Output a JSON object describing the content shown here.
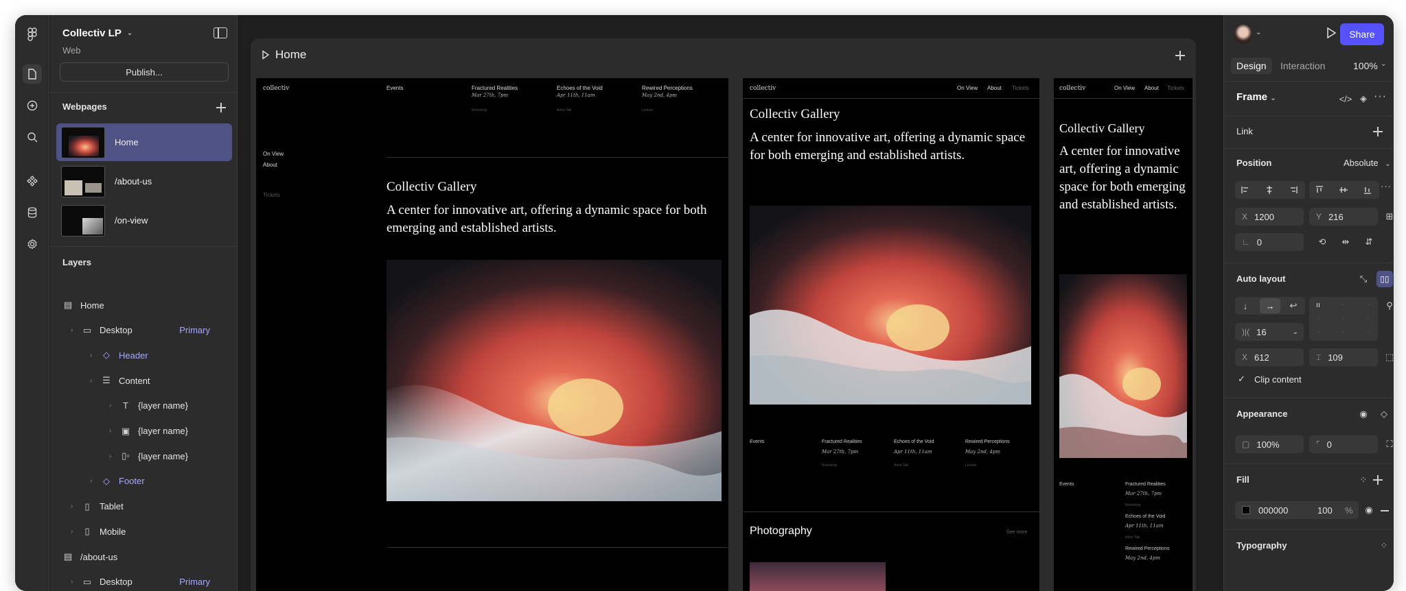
{
  "project": {
    "name": "Collectiv LP",
    "type": "Web",
    "publish_label": "Publish..."
  },
  "webpages": {
    "title": "Webpages",
    "items": [
      {
        "label": "Home",
        "active": true
      },
      {
        "label": "/about-us",
        "active": false
      },
      {
        "label": "/on-view",
        "active": false
      }
    ]
  },
  "layers": {
    "title": "Layers",
    "items": [
      {
        "label": "Home",
        "icon": "page-icon",
        "depth": 0,
        "chevron": false,
        "component": false,
        "tag": ""
      },
      {
        "label": "Desktop",
        "icon": "desktop-icon",
        "depth": 1,
        "chevron": true,
        "component": false,
        "tag": "Primary"
      },
      {
        "label": "Header",
        "icon": "component-icon",
        "depth": 2,
        "chevron": true,
        "component": true,
        "tag": ""
      },
      {
        "label": "Content",
        "icon": "stack-icon",
        "depth": 2,
        "chevron": true,
        "component": false,
        "tag": ""
      },
      {
        "label": "{layer name}",
        "icon": "text-icon",
        "depth": 3,
        "chevron": true,
        "component": false,
        "tag": ""
      },
      {
        "label": "{layer name}",
        "icon": "image-icon",
        "depth": 3,
        "chevron": true,
        "component": false,
        "tag": ""
      },
      {
        "label": "{layer name}",
        "icon": "carousel-icon",
        "depth": 3,
        "chevron": true,
        "component": false,
        "tag": ""
      },
      {
        "label": "Footer",
        "icon": "component-icon",
        "depth": 2,
        "chevron": true,
        "component": true,
        "tag": ""
      },
      {
        "label": "Tablet",
        "icon": "tablet-icon",
        "depth": 1,
        "chevron": true,
        "component": false,
        "tag": ""
      },
      {
        "label": "Mobile",
        "icon": "mobile-icon",
        "depth": 1,
        "chevron": true,
        "component": false,
        "tag": ""
      },
      {
        "label": "/about-us",
        "icon": "page-icon",
        "depth": 0,
        "chevron": false,
        "component": false,
        "tag": ""
      },
      {
        "label": "Desktop",
        "icon": "desktop-icon",
        "depth": 1,
        "chevron": true,
        "component": false,
        "tag": "Primary"
      }
    ]
  },
  "canvas": {
    "frame_title": "Home"
  },
  "site": {
    "logo": "collectiv",
    "gallery_title": "Collectiv Gallery",
    "tagline": "A center for innovative art, offering a dynamic space for both emerging and established artists.",
    "nav_on_view": "On View",
    "nav_about": "About",
    "nav_tickets": "Tickets",
    "events_label": "Events",
    "events": [
      {
        "title": "Fractured Realities",
        "date": "Mar 27th, 7pm",
        "type": "Workshop"
      },
      {
        "title": "Echoes of the Void",
        "date": "Apr 11th, 11am",
        "type": "Artist Talk"
      },
      {
        "title": "Rewired Perceptions",
        "date": "May 2nd, 4pm",
        "type": "Lecture"
      }
    ],
    "photography": "Photography",
    "see_more": "See more"
  },
  "right_panel": {
    "share_label": "Share",
    "tabs": [
      "Design",
      "Interaction"
    ],
    "zoom": "100%",
    "frame_label": "Frame",
    "link_label": "Link",
    "position_label": "Position",
    "position_value": "Absolute",
    "x_label": "X",
    "x_value": "1200",
    "y_label": "Y",
    "y_value": "216",
    "rotation_value": "0",
    "auto_layout_label": "Auto layout",
    "gap_value": "16",
    "pad_x_label": "X",
    "pad_x_value": "612",
    "pad_y_value": "109",
    "clip_label": "Clip content",
    "appearance_label": "Appearance",
    "opacity_value": "100%",
    "radius_value": "0",
    "fill_label": "Fill",
    "fill_hex": "000000",
    "fill_opacity": "100",
    "fill_pct": "%",
    "typography_label": "Typography"
  },
  "colors": {
    "accent": "#5551ff",
    "selected_row": "#4f5285",
    "component": "#a7a8ff",
    "panel": "#2c2c2c",
    "canvas": "#1e1e1e"
  }
}
